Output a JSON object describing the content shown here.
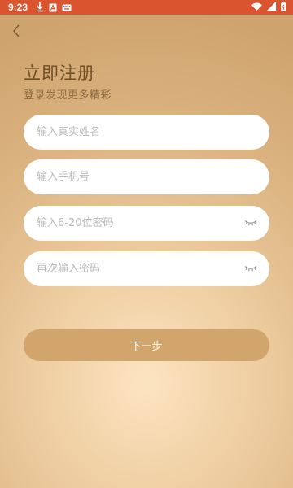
{
  "status_bar": {
    "time": "9:23",
    "left_icons": [
      "download-icon",
      "app-a-icon",
      "keyboard-icon"
    ],
    "right_icons": [
      "wifi-icon",
      "signal-icon",
      "battery-icon"
    ],
    "bar_color": "#d9542f"
  },
  "header": {
    "back_icon": "chevron-left-icon",
    "title": "立即注册",
    "subtitle": "登录发现更多精彩"
  },
  "form": {
    "name_placeholder": "输入真实姓名",
    "name_value": "",
    "phone_placeholder": "输入手机号",
    "phone_value": "",
    "password_placeholder": "输入6-20位密码",
    "password_value": "",
    "confirm_placeholder": "再次输入密码",
    "confirm_value": "",
    "eye_icon": "eye-closed-icon"
  },
  "next_button": {
    "label": "下一步",
    "color": "#d2a56c"
  },
  "colors": {
    "title": "#6f4d25",
    "subtitle": "#8d6b42",
    "background_center": "#fde4c1",
    "background_edge": "#cfa36d"
  }
}
